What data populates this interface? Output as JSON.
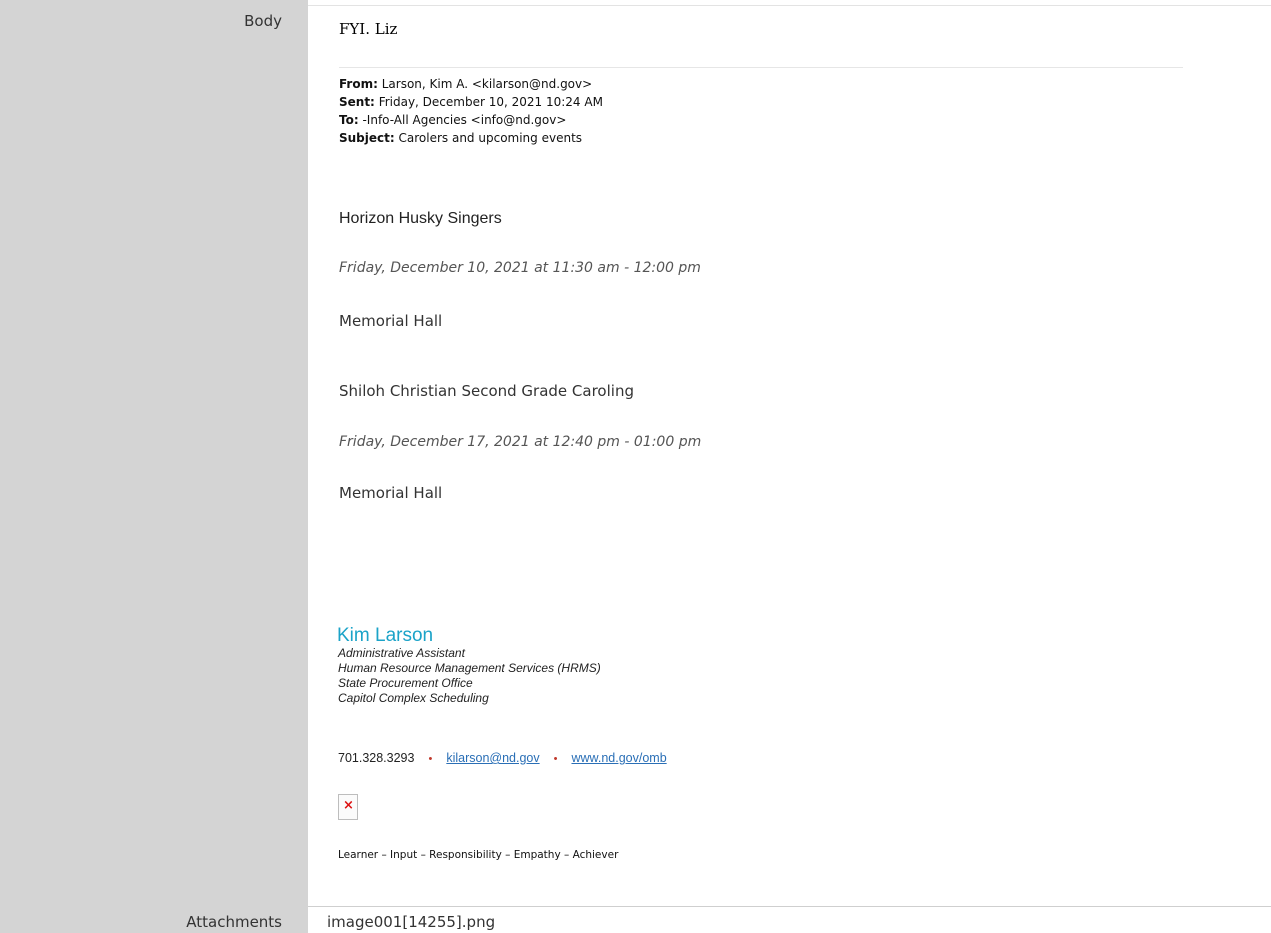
{
  "labels": {
    "body": "Body",
    "attachments": "Attachments"
  },
  "email": {
    "intro": "FYI. Liz",
    "header": {
      "from_label": "From:",
      "from_value": "Larson, Kim A. <kilarson@nd.gov>",
      "sent_label": "Sent:",
      "sent_value": "Friday, December 10, 2021 10:24 AM",
      "to_label": "To:",
      "to_value": "-Info-All Agencies <info@nd.gov>",
      "subject_label": "Subject:",
      "subject_value": "Carolers and upcoming events"
    },
    "events": [
      {
        "title": "Horizon Husky Singers",
        "date": "Friday, December 10, 2021 at 11:30 am - 12:00 pm",
        "location": "Memorial Hall"
      },
      {
        "title": "Shiloh Christian Second Grade Caroling",
        "date": "Friday, December 17, 2021 at 12:40 pm - 01:00 pm",
        "location": "Memorial Hall"
      }
    ],
    "signature": {
      "name": "Kim Larson",
      "lines": [
        "Administrative Assistant",
        "Human Resource Management Services (HRMS)",
        "State Procurement Office",
        "Capitol Complex Scheduling"
      ],
      "phone": "701.328.3293",
      "separator": "•",
      "email": "kilarson@nd.gov",
      "website": "www.nd.gov/omb",
      "broken_image_glyph": "×",
      "strengths": "Learner – Input – Responsibility – Empathy – Achiever"
    }
  },
  "attachments": {
    "file": "image001[14255].png"
  },
  "colors": {
    "label_bg": "#d4d4d4",
    "sig_name": "#1ba3c8",
    "link": "#2a6fb6",
    "separator": "#c0392b"
  }
}
